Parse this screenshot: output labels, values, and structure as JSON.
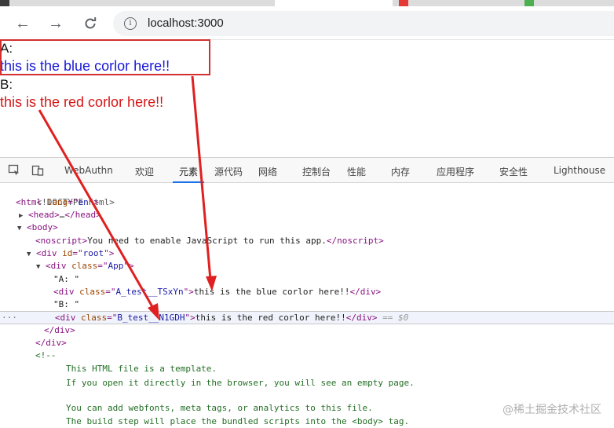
{
  "browser": {
    "url": "localhost:3000",
    "tabstrip_colors": [
      "#3c3c3c",
      "#ffffff",
      "#e53935",
      "#4caf50"
    ]
  },
  "page": {
    "label_a": "A:",
    "text_a": "this is the blue corlor here!!",
    "label_b": "B:",
    "text_b": "this is the red corlor here!!",
    "colors": {
      "blue": "#1a1ad6",
      "red": "#d41616",
      "highlight": "#d32f2f",
      "arrow": "#e02020"
    }
  },
  "devtools": {
    "tabs": [
      {
        "label": "WebAuthn"
      },
      {
        "label": "欢迎"
      },
      {
        "label": "元素"
      },
      {
        "label": "源代码"
      },
      {
        "label": "网络"
      },
      {
        "label": "控制台"
      },
      {
        "label": "性能"
      },
      {
        "label": "内存"
      },
      {
        "label": "应用程序"
      },
      {
        "label": "安全性"
      },
      {
        "label": "Lighthouse"
      }
    ],
    "active_tab": "元素",
    "dom": {
      "doctype": "<!DOCTYPE html>",
      "html_lang": "en",
      "head_collapsed": "…",
      "noscript_text": "You need to enable JavaScript to run this app.",
      "root_id": "root",
      "app_class": "App",
      "text_a": "\"A: \"",
      "div_a_class": "A_test__TSxYn",
      "div_a_text": "this is the blue corlor here!!",
      "text_b": "\"B: \"",
      "div_b_class": "B_test__N1GDH",
      "div_b_text": "this is the red corlor here!!",
      "selected_marker": "== $0",
      "ellipsis": "···",
      "comment_lines": [
        "<!--",
        "This HTML file is a template.",
        "If you open it directly in the browser, you will see an empty page.",
        "",
        "You can add webfonts, meta tags, or analytics to this file.",
        "The build step will place the bundled scripts into the <body> tag."
      ]
    }
  },
  "watermark": "@稀土掘金技术社区"
}
